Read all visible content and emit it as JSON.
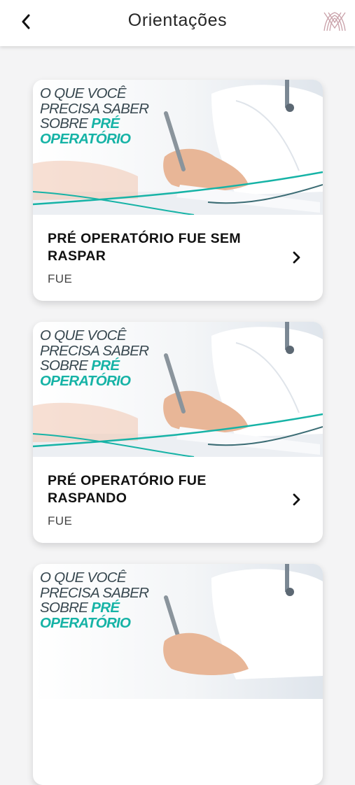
{
  "header": {
    "title": "Orientações",
    "back_icon": "chevron-left-icon",
    "logo_icon": "clinic-logo-icon"
  },
  "cards": [
    {
      "banner": {
        "line1": "O QUE VOCÊ",
        "line2": "PRECISA SABER",
        "line3_prefix": "SOBRE ",
        "line3_highlight": "PRÉ",
        "line4": "OPERATÓRIO"
      },
      "title": "PRÉ OPERATÓRIO FUE SEM RASPAR",
      "category": "FUE"
    },
    {
      "banner": {
        "line1": "O QUE VOCÊ",
        "line2": "PRECISA SABER",
        "line3_prefix": "SOBRE ",
        "line3_highlight": "PRÉ",
        "line4": "OPERATÓRIO"
      },
      "title": "PRÉ OPERATÓRIO FUE RASPANDO",
      "category": "FUE"
    },
    {
      "banner": {
        "line1": "O QUE VOCÊ",
        "line2": "PRECISA SABER",
        "line3_prefix": "SOBRE ",
        "line3_highlight": "PRÉ",
        "line4": "OPERATÓRIO"
      },
      "title": "",
      "category": ""
    }
  ],
  "colors": {
    "accent": "#16b3a6",
    "headline": "#37474f",
    "logo": "#c9a1a9"
  }
}
